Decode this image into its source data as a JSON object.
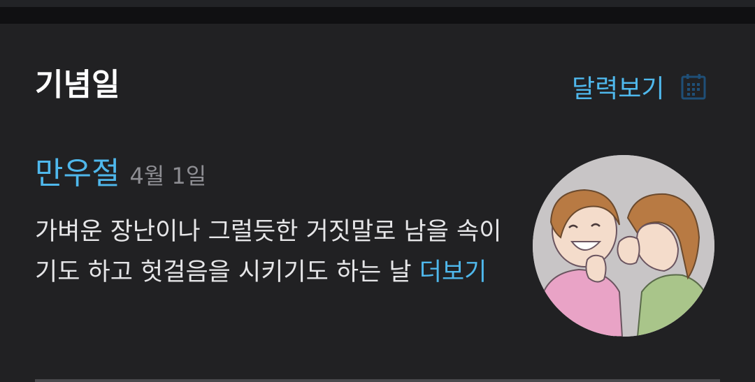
{
  "anniversary": {
    "section_title": "기념일",
    "calendar_link_label": "달력보기",
    "calendar_icon": "calendar-icon",
    "event": {
      "name": "만우절",
      "date": "4월 1일",
      "description": "가벼운 장난이나 그럴듯한 거짓말로 남을 속이기도 하고 헛걸음을 시키기도 하는 날",
      "more_label": "더보기",
      "image_subject": "two-people-whispering-and-laughing"
    }
  },
  "colors": {
    "background": "#212123",
    "accent": "#4fb8ec",
    "text_primary": "#ffffff",
    "text_secondary": "#8e8e93"
  }
}
